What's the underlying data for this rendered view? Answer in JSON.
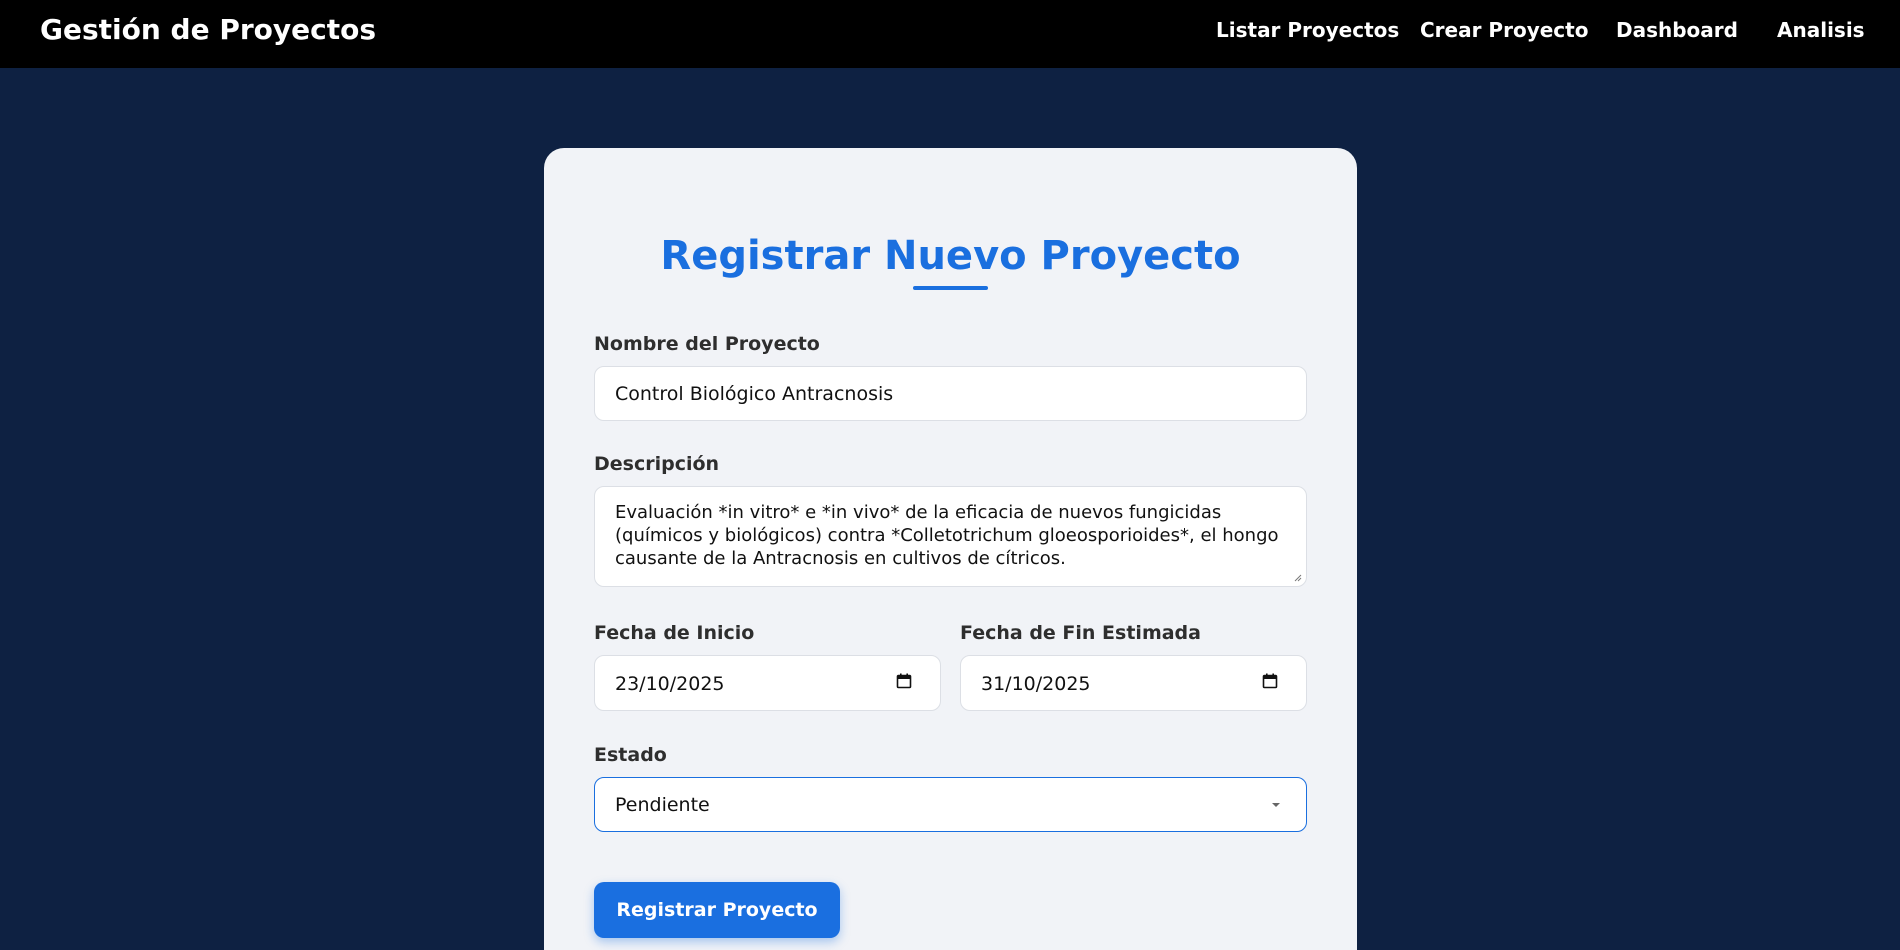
{
  "header": {
    "brand": "Gestión de Proyectos",
    "nav": [
      "Listar Proyectos",
      "Crear Proyecto",
      "Dashboard",
      "Analisis"
    ]
  },
  "form": {
    "title": "Registrar Nuevo Proyecto",
    "name_label": "Nombre del Proyecto",
    "name_value": "Control Biológico Antracnosis",
    "description_label": "Descripción",
    "description_lines": [
      "Evaluación *in vitro* e *in vivo* de la eficacia de nuevos fungicidas",
      "(químicos y biológicos) contra *Colletotrichum gloeosporioides*, el hongo",
      "causante de la Antracnosis en cultivos de cítricos."
    ],
    "start_label": "Fecha de Inicio",
    "start_value": "23/10/2025",
    "end_label": "Fecha de Fin Estimada",
    "end_value": "31/10/2025",
    "status_label": "Estado",
    "status_value": "Pendiente",
    "submit_label": "Registrar Proyecto"
  },
  "icons": {
    "start_date": "calendar-icon",
    "end_date": "calendar-icon",
    "status": "chevron-down-icon"
  },
  "colors": {
    "page_background": "#0e2142",
    "header_background": "#000000",
    "accent": "#1a6fdf",
    "card_background": "#f1f3f7"
  }
}
